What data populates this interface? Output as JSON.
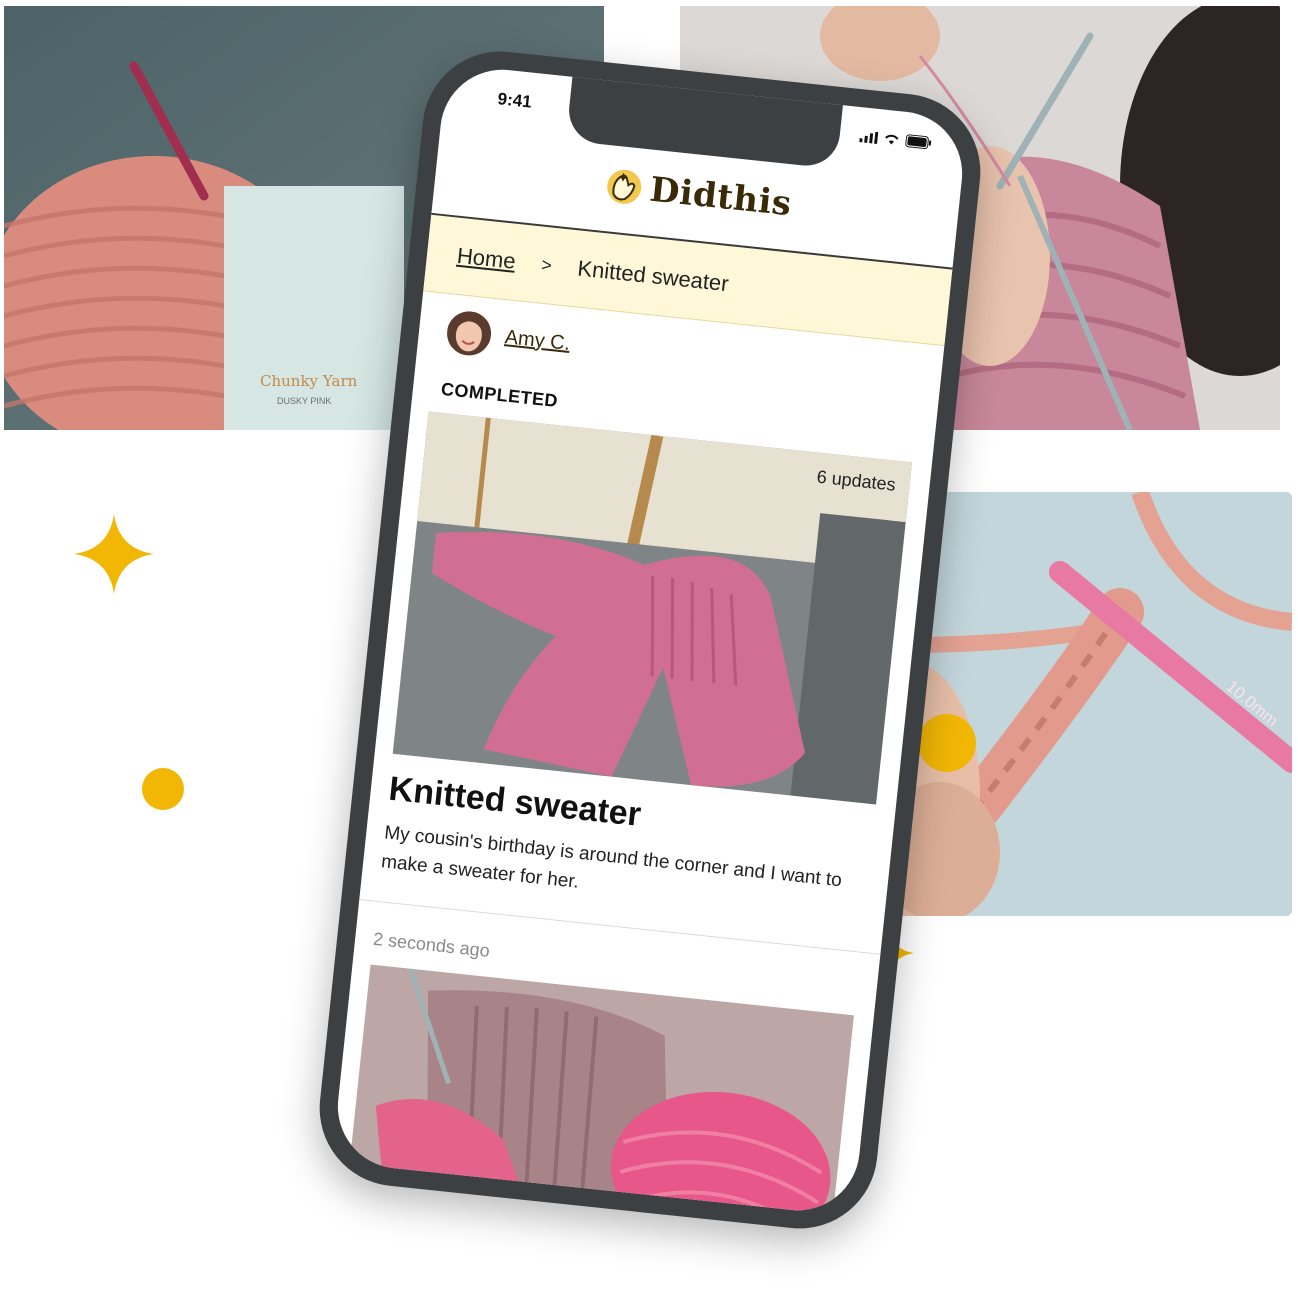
{
  "status_bar": {
    "time": "9:41"
  },
  "app": {
    "name": "Didthis",
    "logo_icon": "hand-sparkle-icon"
  },
  "breadcrumb": {
    "home": "Home",
    "separator": ">",
    "current": "Knitted sweater"
  },
  "author": {
    "name": "Amy C."
  },
  "project": {
    "status": "COMPLETED",
    "updates": "6 updates",
    "title": "Knitted sweater",
    "description": "My cousin's birthday is around the corner and I want to make a sweater for her."
  },
  "update": {
    "timestamp": "2 seconds ago"
  },
  "photos": {
    "yarn_label_brand": "Chunky Yarn",
    "yarn_label_color": "DUSKY PINK",
    "hook_size": "10.0mm"
  },
  "colors": {
    "accent": "#f2b705",
    "brand_text": "#3a2a08",
    "breadcrumb_bg": "#fff8d8",
    "frame": "#3d4043"
  }
}
